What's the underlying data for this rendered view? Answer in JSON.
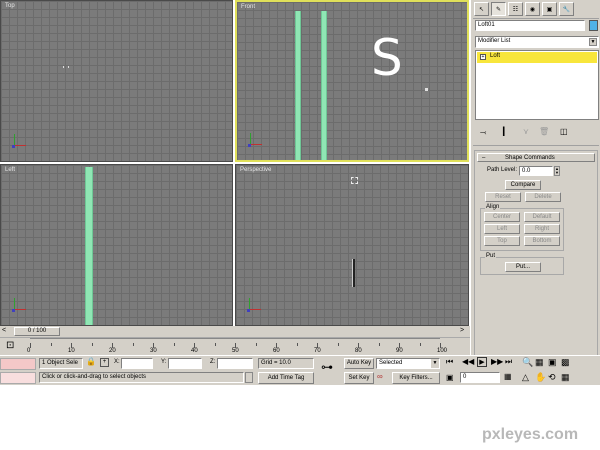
{
  "viewports": {
    "top": {
      "label": "Top"
    },
    "front": {
      "label": "Front",
      "overlay_text": "S"
    },
    "left": {
      "label": "Left"
    },
    "perspective": {
      "label": "Perspective"
    }
  },
  "command_panel": {
    "tabs": [
      "create-icon",
      "modify-icon",
      "hierarchy-icon",
      "motion-icon",
      "display-icon",
      "utilities-icon"
    ],
    "object_name": "Loft01",
    "object_color": "#4fb2e6",
    "modifier_list": "Modifier List",
    "stack_item": "Loft",
    "stack_item_color": "#f8e63c",
    "rollout_title": "Shape Commands",
    "path_level_label": "Path Level:",
    "path_level_value": "0.0",
    "compare_label": "Compare",
    "reset_label": "Reset",
    "delete_label": "Delete",
    "align_label": "Align",
    "center_label": "Center",
    "default_label": "Default",
    "left_label": "Left",
    "right_label": "Right",
    "top_label": "Top",
    "bottom_label": "Bottom",
    "output_label": "Put",
    "put_label": "Put..."
  },
  "timeline": {
    "frame_counter": "0 / 100",
    "ticks": [
      "0",
      "10",
      "20",
      "30",
      "40",
      "50",
      "60",
      "70",
      "80",
      "90",
      "100"
    ]
  },
  "status": {
    "selection": "1 Object Sele",
    "x_label": "X:",
    "y_label": "Y:",
    "z_label": "Z:",
    "grid": "Grid = 10.0",
    "auto_key": "Auto Key",
    "set_key": "Set Key",
    "key_mode": "Selected",
    "key_filters": "Key Filters...",
    "add_time_tag": "Add Time Tag",
    "prompt": "Click or click-and-drag to select objects",
    "frame_value": "0"
  },
  "watermark": "pxleyes.com"
}
